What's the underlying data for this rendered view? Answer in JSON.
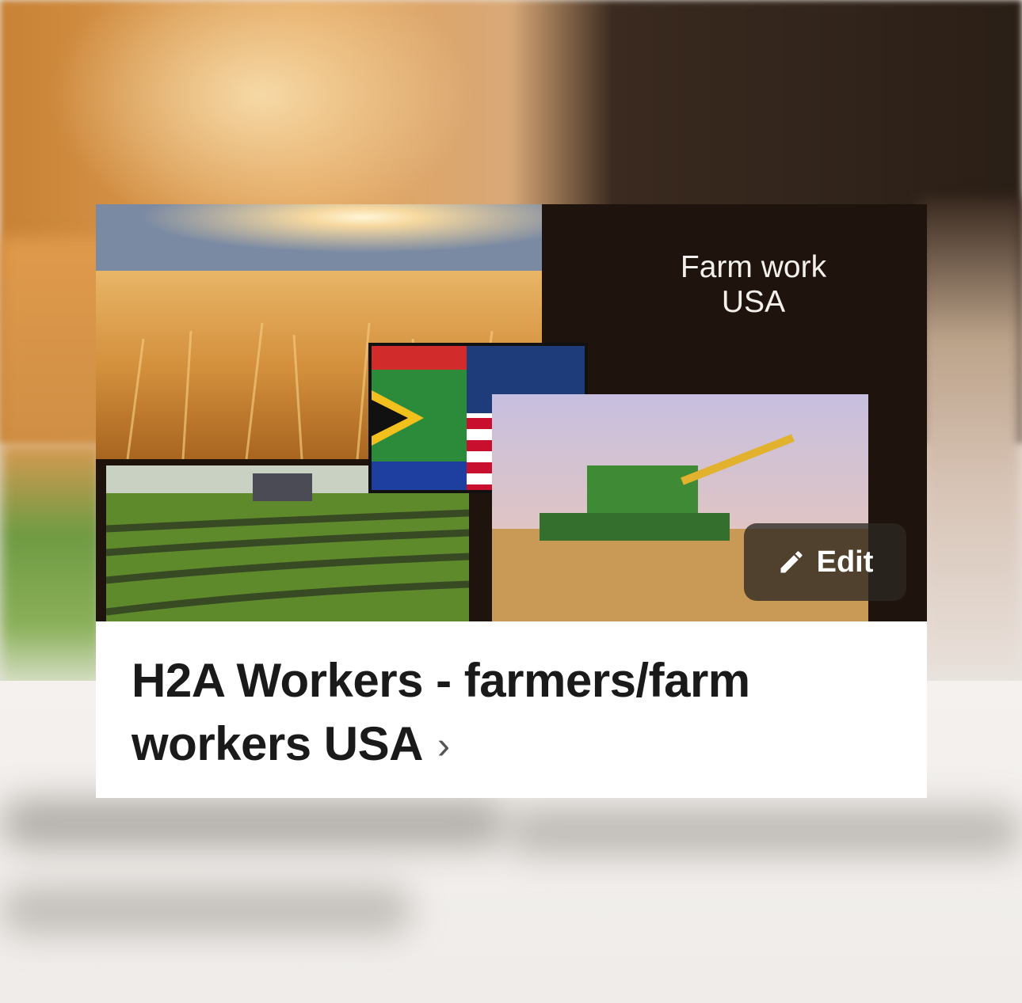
{
  "cover": {
    "caption_line1": "Farm work",
    "caption_line2": "USA",
    "edit_label": "Edit"
  },
  "group": {
    "title": "H2A Workers - farmers/farm workers USA",
    "chevron": "›"
  },
  "icons": {
    "edit": "pencil-icon",
    "chevron": "chevron-right-icon"
  },
  "colors": {
    "cover_background": "#1f140d",
    "edit_button": "#2d2823",
    "title_text": "#1a1a1a"
  }
}
